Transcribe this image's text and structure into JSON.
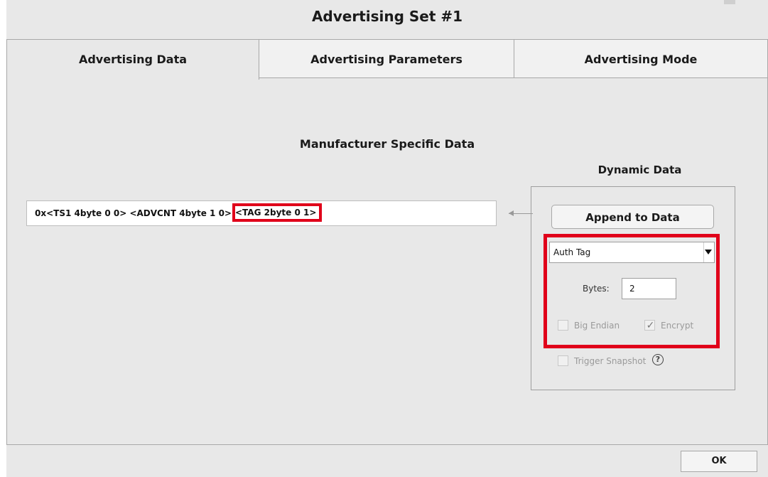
{
  "window": {
    "title": "Advertising Set #1"
  },
  "tabs": [
    {
      "label": "Advertising Data"
    },
    {
      "label": "Advertising Parameters"
    },
    {
      "label": "Advertising Mode"
    }
  ],
  "main": {
    "section_title": "Manufacturer Specific Data",
    "data_field": {
      "prefix": "0x",
      "part1": "<TS1 4byte 0 0>",
      "part2": "<ADVCNT 4byte 1 0>",
      "tag": "<TAG 2byte 0 1>"
    }
  },
  "dynamic": {
    "title": "Dynamic Data",
    "append_label": "Append to Data",
    "type_selected": "Auth Tag",
    "bytes_label": "Bytes:",
    "bytes_value": "2",
    "big_endian_label": "Big Endian",
    "big_endian_checked": false,
    "encrypt_label": "Encrypt",
    "encrypt_checked": true,
    "encrypt_mark": "✓",
    "trigger_label": "Trigger Snapshot",
    "trigger_checked": false,
    "help_glyph": "?"
  },
  "footer": {
    "ok_label": "OK"
  },
  "colors": {
    "highlight": "#e0001a",
    "panel_bg": "#e8e8e8"
  }
}
